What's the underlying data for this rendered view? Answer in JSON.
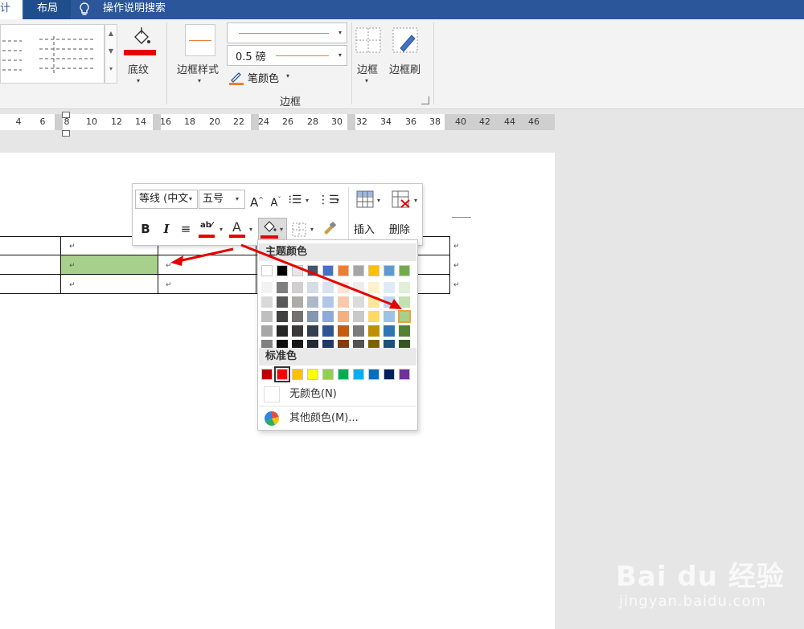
{
  "tabs": {
    "design_partial": "计",
    "layout": "布局",
    "tell_me": "操作说明搜索"
  },
  "ribbon": {
    "shading_label": "底纹",
    "border_styles_label": "边框样式",
    "weight_value": "0.5 磅",
    "pen_color_label": "笔颜色",
    "borders_label": "边框",
    "border_painter_label": "边框刷",
    "group_label": "边框"
  },
  "ruler": {
    "numbers": [
      "4",
      "6",
      "8",
      "10",
      "12",
      "14",
      "16",
      "18",
      "20",
      "22",
      "24",
      "26",
      "28",
      "30",
      "32",
      "34",
      "36",
      "38",
      "40",
      "42",
      "44",
      "46"
    ]
  },
  "mini_toolbar": {
    "font_name": "等线 (中文",
    "font_size": "五号",
    "bold": "B",
    "italic": "I",
    "insert_label": "插入",
    "delete_label": "删除"
  },
  "palette": {
    "theme_colors_label": "主题颜色",
    "standard_colors_label": "标准色",
    "no_color_label": "无颜色(N)",
    "more_colors_label": "其他颜色(M)...",
    "theme_top": [
      "#ffffff",
      "#000000",
      "#e7e6e6",
      "#44546a",
      "#4472c4",
      "#ed7d31",
      "#a5a5a5",
      "#ffc000",
      "#5b9bd5",
      "#70ad47"
    ],
    "theme_shades": [
      [
        "#f2f2f2",
        "#d9d9d9",
        "#bfbfbf",
        "#a6a6a6",
        "#808080"
      ],
      [
        "#7f7f7f",
        "#595959",
        "#404040",
        "#262626",
        "#0d0d0d"
      ],
      [
        "#d0cece",
        "#aeabab",
        "#757171",
        "#3a3838",
        "#171616"
      ],
      [
        "#d6dce4",
        "#adb9ca",
        "#8497b0",
        "#333f4f",
        "#222a35"
      ],
      [
        "#d9e2f3",
        "#b4c6e7",
        "#8eaadb",
        "#2f5496",
        "#1f3864"
      ],
      [
        "#fbe4d5",
        "#f7caac",
        "#f4b083",
        "#c55a11",
        "#833c0b"
      ],
      [
        "#ededed",
        "#dbdbdb",
        "#c9c9c9",
        "#7b7b7b",
        "#525252"
      ],
      [
        "#fff2cc",
        "#ffe599",
        "#ffd966",
        "#bf8f00",
        "#7f6000"
      ],
      [
        "#deebf6",
        "#bdd7ee",
        "#9cc2e5",
        "#2e75b5",
        "#1e4e79"
      ],
      [
        "#e2efd9",
        "#c5e0b3",
        "#a8d08d",
        "#538135",
        "#375623"
      ]
    ],
    "standard": [
      "#c00000",
      "#ff0000",
      "#ffc000",
      "#ffff00",
      "#92d050",
      "#00b050",
      "#00b0f0",
      "#0070c0",
      "#002060",
      "#7030a0"
    ],
    "selected_fill": "#a8d08d",
    "accent_red": "#e60000"
  },
  "watermark": {
    "brand": "Bai du 经验",
    "url": "jingyan.baidu.com"
  }
}
